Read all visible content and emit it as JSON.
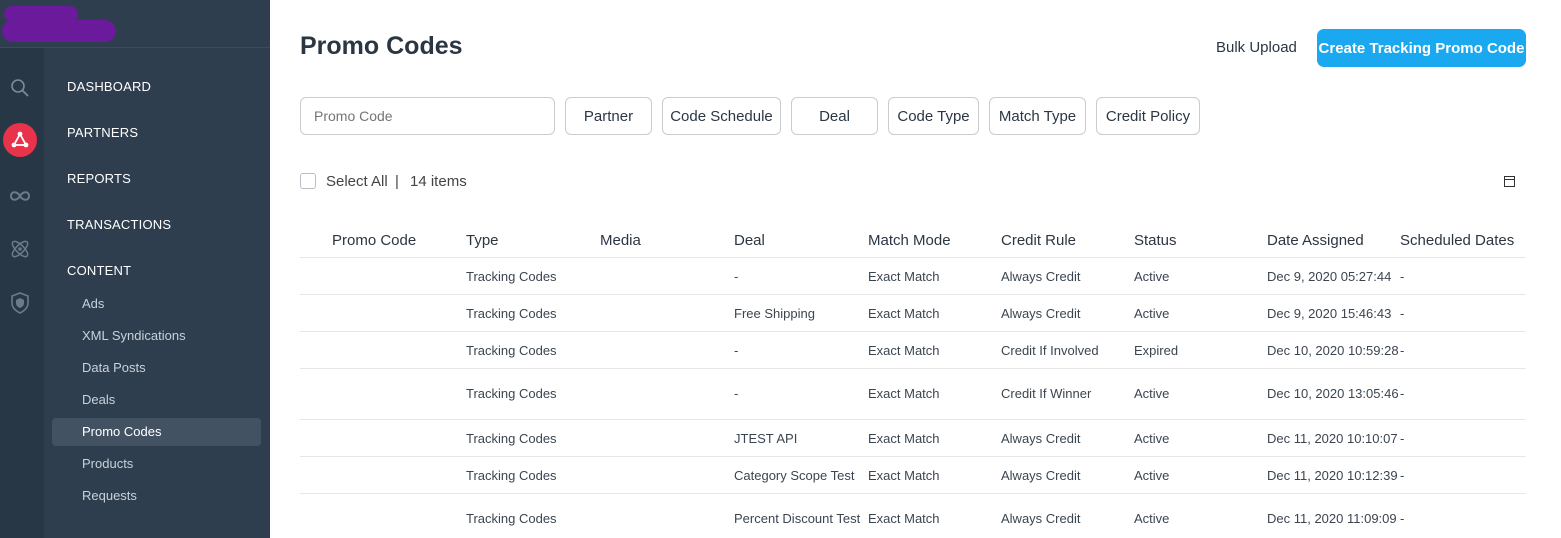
{
  "sidebar": {
    "items": [
      {
        "label": "DASHBOARD"
      },
      {
        "label": "PARTNERS"
      },
      {
        "label": "REPORTS"
      },
      {
        "label": "TRANSACTIONS"
      },
      {
        "label": "CONTENT"
      }
    ],
    "content_sub_items": [
      {
        "label": "Ads"
      },
      {
        "label": "XML Syndications"
      },
      {
        "label": "Data Posts"
      },
      {
        "label": "Deals"
      },
      {
        "label": "Promo Codes",
        "active": true
      },
      {
        "label": "Products"
      },
      {
        "label": "Requests"
      }
    ],
    "rail_icons": [
      "search-icon",
      "partners-network-icon",
      "infinity-icon",
      "atom-icon",
      "shield-icon"
    ]
  },
  "page": {
    "title": "Promo Codes",
    "bulk_upload_label": "Bulk Upload",
    "create_label": "Create Tracking Promo Code"
  },
  "filters": {
    "search_placeholder": "Promo Code",
    "buttons": [
      "Partner",
      "Code Schedule",
      "Deal",
      "Code Type",
      "Match Type",
      "Credit Policy"
    ]
  },
  "selection": {
    "select_all_label": "Select All",
    "separator": "|",
    "count_label": "14 items"
  },
  "table": {
    "columns": [
      "Promo Code",
      "Type",
      "Media",
      "Deal",
      "Match Mode",
      "Credit Rule",
      "Status",
      "Date Assigned",
      "Scheduled Dates"
    ],
    "rows": [
      {
        "promo": "",
        "type": "Tracking Codes",
        "media": "",
        "deal": "-",
        "match": "Exact Match",
        "credit": "Always Credit",
        "status": "Active",
        "date": "Dec 9, 2020 05:27:44",
        "scheduled": "-"
      },
      {
        "promo": "",
        "type": "Tracking Codes",
        "media": "",
        "deal": "Free Shipping",
        "match": "Exact Match",
        "credit": "Always Credit",
        "status": "Active",
        "date": "Dec 9, 2020 15:46:43",
        "scheduled": "-"
      },
      {
        "promo": "",
        "type": "Tracking Codes",
        "media": "",
        "deal": "-",
        "match": "Exact Match",
        "credit": "Credit If Involved",
        "status": "Expired",
        "date": "Dec 10, 2020 10:59:28",
        "scheduled": "-"
      },
      {
        "promo": "",
        "type": "Tracking Codes",
        "media": "",
        "deal": "-",
        "match": "Exact Match",
        "credit": "Credit If Winner",
        "status": "Active",
        "date": "Dec 10, 2020 13:05:46",
        "scheduled": "-"
      },
      {
        "promo": "",
        "type": "Tracking Codes",
        "media": "",
        "deal": "JTEST API",
        "match": "Exact Match",
        "credit": "Always Credit",
        "status": "Active",
        "date": "Dec 11, 2020 10:10:07",
        "scheduled": "-"
      },
      {
        "promo": "",
        "type": "Tracking Codes",
        "media": "",
        "deal": "Category Scope Test",
        "match": "Exact Match",
        "credit": "Always Credit",
        "status": "Active",
        "date": "Dec 11, 2020 10:12:39",
        "scheduled": "-"
      },
      {
        "promo": "",
        "type": "Tracking Codes",
        "media": "",
        "deal": "Percent Discount Test",
        "match": "Exact Match",
        "credit": "Always Credit",
        "status": "Active",
        "date": "Dec 11, 2020 11:09:09",
        "scheduled": "-"
      }
    ]
  },
  "colors": {
    "sidebar_bg": "#2f3e4e",
    "rail_bg": "#283746",
    "accent": "#1aa9f0",
    "active_icon": "#e8334a",
    "brand_blur": "#6a1a9a"
  }
}
